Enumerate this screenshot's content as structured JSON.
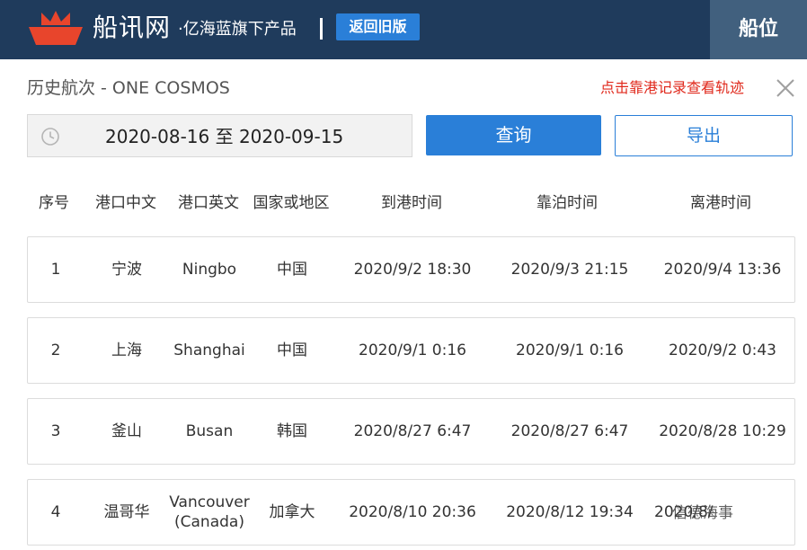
{
  "header": {
    "brand": "船讯网",
    "slogan": "·亿海蓝旗下产品",
    "back_button": "返回旧版",
    "position_tab": "船位"
  },
  "panel": {
    "title": "历史航次 - ONE COSMOS",
    "track_link": "点击靠港记录查看轨迹",
    "date_range": "2020-08-16 至 2020-09-15",
    "query_button": "查询",
    "export_button": "导出"
  },
  "table": {
    "headers": [
      "序号",
      "港口中文",
      "港口英文",
      "国家或地区",
      "到港时间",
      "靠泊时间",
      "离港时间"
    ],
    "rows": [
      {
        "no": "1",
        "port_cn": "宁波",
        "port_en": "Ningbo",
        "country": "中国",
        "arrival": "2020/9/2 18:30",
        "berth": "2020/9/3 21:15",
        "departure": "2020/9/4 13:36"
      },
      {
        "no": "2",
        "port_cn": "上海",
        "port_en": "Shanghai",
        "country": "中国",
        "arrival": "2020/9/1 0:16",
        "berth": "2020/9/1 0:16",
        "departure": "2020/9/2 0:43"
      },
      {
        "no": "3",
        "port_cn": "釜山",
        "port_en": "Busan",
        "country": "韩国",
        "arrival": "2020/8/27 6:47",
        "berth": "2020/8/27 6:47",
        "departure": "2020/8/28 10:29"
      },
      {
        "no": "4",
        "port_cn": "温哥华",
        "port_en": "Vancouver\n(Canada)",
        "country": "加拿大",
        "arrival": "2020/8/10 20:36",
        "berth": "2020/8/12 19:34",
        "departure": "2020/8/"
      }
    ]
  },
  "watermark": "信德海事",
  "colors": {
    "header_bg": "#1f3b5c",
    "accent_blue": "#2a7fd8",
    "link_red": "#e0291c",
    "logo_red": "#e8452c"
  }
}
